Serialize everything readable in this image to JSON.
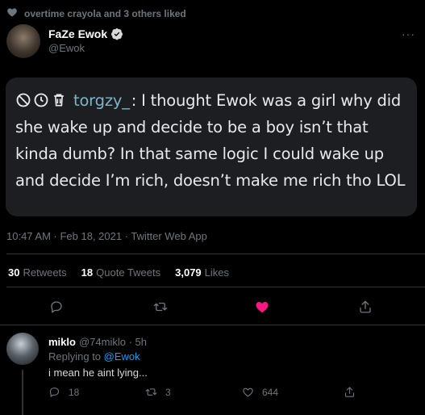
{
  "liked_bar": {
    "text": "overtime crayola and 3 others liked"
  },
  "tweet": {
    "author_name": "FaZe Ewok",
    "author_handle": "@Ewok",
    "more": "···",
    "quote": {
      "username": "torgzy_",
      "text": ": I thought Ewok was a girl why did she wake up and decide to be a boy isn’t that kinda dumb? In that same logic I could wake up and decide I’m rich, doesn’t make me rich tho LOL"
    },
    "meta": "10:47 AM · Feb 18, 2021 · Twitter Web App",
    "stats": {
      "retweets_count": "30",
      "retweets_label": "Retweets",
      "quotes_count": "18",
      "quotes_label": "Quote Tweets",
      "likes_count": "3,079",
      "likes_label": "Likes"
    },
    "actions": [
      "reply-icon",
      "retweet-icon",
      "heart-icon",
      "share-icon"
    ],
    "liked": true
  },
  "reply": {
    "author_name": "miklo",
    "author_handle": "@74miklo · 5h",
    "replying_prefix": "Replying to",
    "replying_handle": "@Ewok",
    "text": "i mean he aint lying...",
    "counts": {
      "replies": "18",
      "retweets": "3",
      "likes": "644"
    }
  },
  "colors": {
    "background": "#000000",
    "card": "#1c1e21",
    "muted": "#6e767d",
    "link": "#1d9bf0",
    "heart": "#f91880",
    "quote_user": "#7fb3c6"
  }
}
